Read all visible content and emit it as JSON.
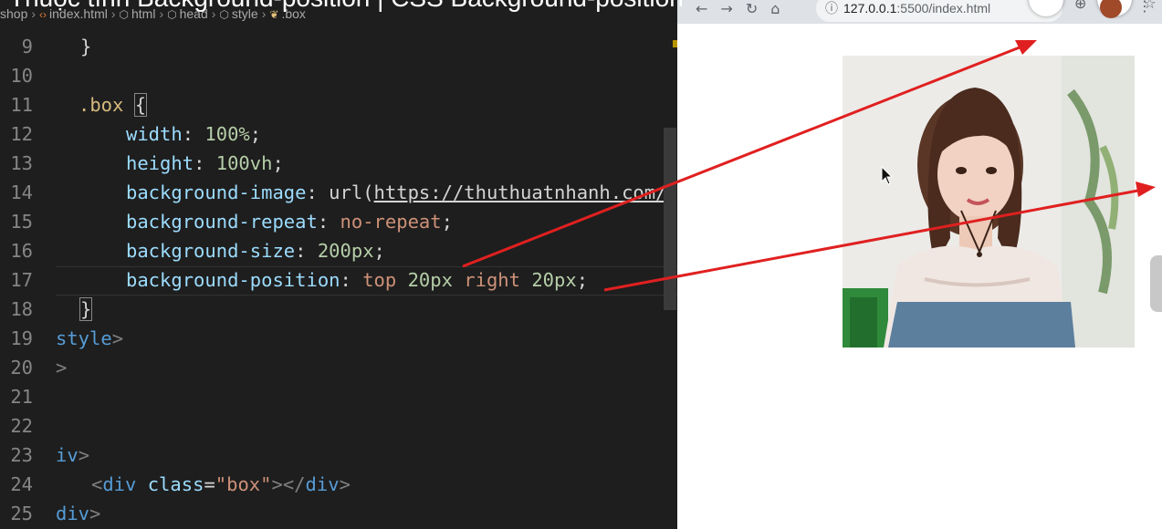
{
  "video_title": "Thuộc tính Background-position | CSS Background-position",
  "breadcrumb": {
    "items": [
      "shop",
      "index.html",
      "html",
      "head",
      "style",
      ".box"
    ]
  },
  "editor": {
    "lines": [
      {
        "num": "9"
      },
      {
        "num": "10"
      },
      {
        "num": "11"
      },
      {
        "num": "12"
      },
      {
        "num": "13"
      },
      {
        "num": "14"
      },
      {
        "num": "15"
      },
      {
        "num": "16"
      },
      {
        "num": "17"
      },
      {
        "num": "18"
      },
      {
        "num": "19"
      },
      {
        "num": "20"
      },
      {
        "num": "21"
      },
      {
        "num": "22"
      },
      {
        "num": "23"
      },
      {
        "num": "24"
      },
      {
        "num": "25"
      }
    ],
    "code": {
      "l9_brace": "}",
      "l11_selector": ".box",
      "l11_brace": "{",
      "l12_prop": "width",
      "l12_val": "100%",
      "l13_prop": "height",
      "l13_val": "100vh",
      "l14_prop": "background-image",
      "l14_fn": "url(",
      "l14_url": "https://thuthuatnhanh.com/",
      "l15_prop": "background-repeat",
      "l15_val": "no-repeat",
      "l16_prop": "background-size",
      "l16_val": "200px",
      "l17_prop": "background-position",
      "l17_kw1": "top",
      "l17_num1": "20px",
      "l17_kw2": "right",
      "l17_num2": "20px",
      "l18_brace": "}",
      "l19_tag": "style",
      "l19_close": ">",
      "l20": ">",
      "l23_tag": "iv",
      "l23_close": ">",
      "l24_open": "<",
      "l24_tag": "div",
      "l24_attr": "class",
      "l24_eq": "=",
      "l24_val": "\"box\"",
      "l24_close": "></",
      "l24_tag2": "div",
      "l24_end": ">",
      "l25_tag": "div",
      "l25_close": ">"
    }
  },
  "browser": {
    "url_host": "127.0.0.1",
    "url_path": ":5500/index.html"
  },
  "colors": {
    "editor_bg": "#1e1e1e",
    "arrow": "#e02020"
  },
  "icons": [
    "back-icon",
    "forward-icon",
    "reload-icon",
    "home-icon",
    "info-icon",
    "zoom-icon",
    "star-icon",
    "kebab-menu-icon",
    "cursor-icon"
  ]
}
